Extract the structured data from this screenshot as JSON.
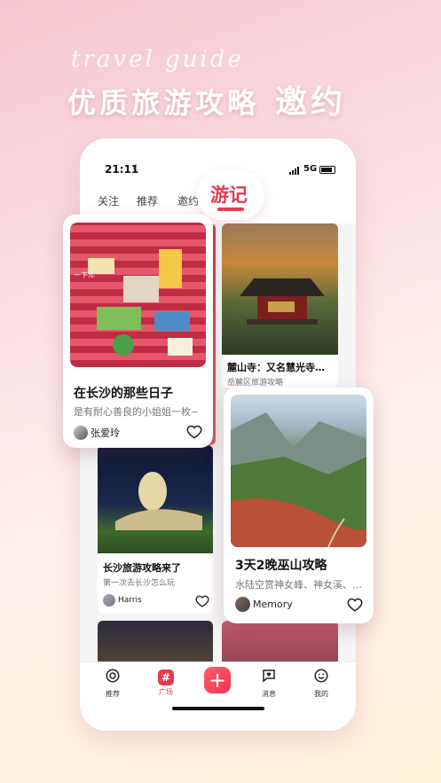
{
  "banner": {
    "script_title": "travel guide",
    "title": "优质旅游攻略",
    "title_emphasis": "邀约"
  },
  "status_bar": {
    "time": "21:11",
    "network": "5G"
  },
  "tabs": [
    {
      "label": "关注"
    },
    {
      "label": "推荐"
    },
    {
      "label": "邀约"
    },
    {
      "label": "游记",
      "active": true
    }
  ],
  "feed": {
    "cards": [
      {
        "title": "麓山寺：又名慧光寺…",
        "subtitle": "岳麓区旅游攻略"
      },
      {
        "title": "长沙旅游攻略来了",
        "subtitle": "第一次去长沙怎么玩",
        "author": "Harris"
      }
    ]
  },
  "floating_cards": [
    {
      "title": "在长沙的那些日子",
      "subtitle": "是有耐心善良的小姐姐一枚~",
      "author": "张爱玲",
      "image_text": "一下ル"
    },
    {
      "title": "3天2晚巫山攻略",
      "subtitle": "水陆空赏神女峰、神女溪、…",
      "author": "Memory"
    }
  ],
  "bottom_nav": [
    {
      "label": "推荐",
      "icon": "camera-icon"
    },
    {
      "label": "广场",
      "icon": "hashtag-icon",
      "active": true
    },
    {
      "label": "",
      "icon": "plus-icon"
    },
    {
      "label": "消息",
      "icon": "message-heart-icon"
    },
    {
      "label": "我的",
      "icon": "smile-icon"
    }
  ],
  "colors": {
    "accent": "#e33b52",
    "background_top": "#f6c6cf",
    "background_bottom": "#fdf3d8"
  }
}
